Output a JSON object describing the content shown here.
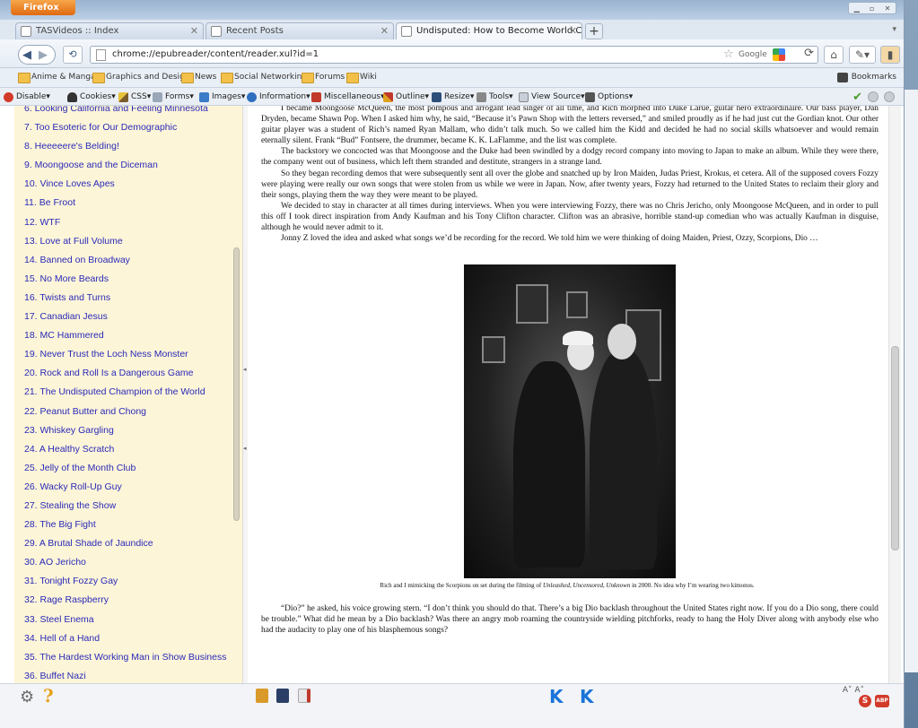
{
  "browser": {
    "app_button": "Firefox",
    "tabs": [
      {
        "label": "TASVideos :: Index",
        "active": false
      },
      {
        "label": "Recent Posts",
        "active": false
      },
      {
        "label": "Undisputed: How to Become World Champi...",
        "active": true
      }
    ],
    "url": "chrome://epubreader/content/reader.xul?id=1",
    "search_engine": "Google",
    "bookmarks": [
      "Anime & Manga",
      "Graphics and Design",
      "News",
      "Social Networking",
      "Forums",
      "Wiki"
    ],
    "bookmarks_menu": "Bookmarks",
    "toolbar": [
      "Disable▾",
      "Cookies▾",
      "CSS▾",
      "Forms▾",
      "Images▾",
      "Information▾",
      "Miscellaneous▾",
      "Outline▾",
      "Resize▾",
      "Tools▾",
      "View Source▾",
      "Options▾"
    ]
  },
  "toc": {
    "items": [
      "6. Looking California and Feeling Minnesota",
      "7. Too Esoteric for Our Demographic",
      "8. Heeeeere's Belding!",
      "9. Moongoose and the Diceman",
      "10. Vince Loves Apes",
      "11. Be Froot",
      "12. WTF",
      "13. Love at Full Volume",
      "14. Banned on Broadway",
      "15. No More Beards",
      "16. Twists and Turns",
      "17. Canadian Jesus",
      "18. MC Hammered",
      "19. Never Trust the Loch Ness Monster",
      "20. Rock and Roll Is a Dangerous Game",
      "21. The Undisputed Champion of the World",
      "22. Peanut Butter and Chong",
      "23. Whiskey Gargling",
      "24. A Healthy Scratch",
      "25. Jelly of the Month Club",
      "26. Wacky Roll-Up Guy",
      "27. Stealing the Show",
      "28. The Big Fight",
      "29. A Brutal Shade of Jaundice",
      "30. AO Jericho",
      "31. Tonight Fozzy Gay",
      "32. Rage Raspberry",
      "33. Steel Enema",
      "34. Hell of a Hand",
      "35. The Hardest Working Man in Show Business",
      "36. Buffet Nazi"
    ]
  },
  "reader": {
    "paragraphs": [
      "I became Moongoose McQueen, the most pompous and arrogant lead singer of all time, and Rich morphed into Duke Larue, guitar hero extraordinaire. Our bass player, Dan Dryden, became Shawn Pop. When I asked him why, he said, “Because it’s Pawn Shop with the letters reversed,” and smiled proudly as if he had just cut the Gordian knot. Our other guitar player was a student of Rich’s named Ryan Mallam, who didn’t talk much. So we called him the Kidd and decided he had no social skills whatsoever and would remain eternally silent. Frank “Bud” Fontsere, the drummer, became K. K. LaFlamme, and the list was complete.",
      "The backstory we concocted was that Moongoose and the Duke had been swindled by a dodgy record company into moving to Japan to make an album. While they were there, the company went out of business, which left them stranded and destitute, strangers in a strange land.",
      "So they began recording demos that were subsequently sent all over the globe and snatched up by Iron Maiden, Judas Priest, Krokus, et cetera. All of the supposed covers Fozzy were playing were really our own songs that were stolen from us while we were in Japan. Now, after twenty years, Fozzy had returned to the United States to reclaim their glory and their songs, playing them the way they were meant to be played.",
      "We decided to stay in character at all times during interviews. When you were interviewing Fozzy, there was no Chris Jericho, only Moongoose McQueen, and in order to pull this off I took direct inspiration from Andy Kaufman and his Tony Clifton character. Clifton was an abrasive, horrible stand-up comedian who was actually Kaufman in disguise, although he would never admit to it.",
      "Jonny Z loved the idea and asked what songs we’d be recording for the record. We told him we were thinking of doing Maiden, Priest, Ozzy, Scorpions, Dio …"
    ],
    "caption_pre": "Rich and I mimicking the Scorpions on set during the filming of ",
    "caption_title": "Unleashed, Uncensored, Unknown",
    "caption_post": " in 2000. No idea why I’m wearing two kimonos.",
    "paragraph_after": "“Dio?” he asked, his voice growing stern. “I don’t think you should do that. There’s a big Dio backlash throughout the United States right now. If you do a Dio song, there could be trouble.” What did he mean by a Dio backlash? Was there an angry mob roaming the countryside wielding pitchforks, ready to hang the Holy Diver along with anybody else who had the audacity to play one of his blasphemous songs?"
  },
  "statusbar": {
    "help_glyph": "?",
    "prev_glyph": "K",
    "next_glyph": "ᴋ",
    "font_controls": "A˅ A˄"
  },
  "colors": {
    "toc_bg": "#fdf5d8",
    "toc_link": "#2a2ab8",
    "nav_blue": "#1a73d9"
  }
}
